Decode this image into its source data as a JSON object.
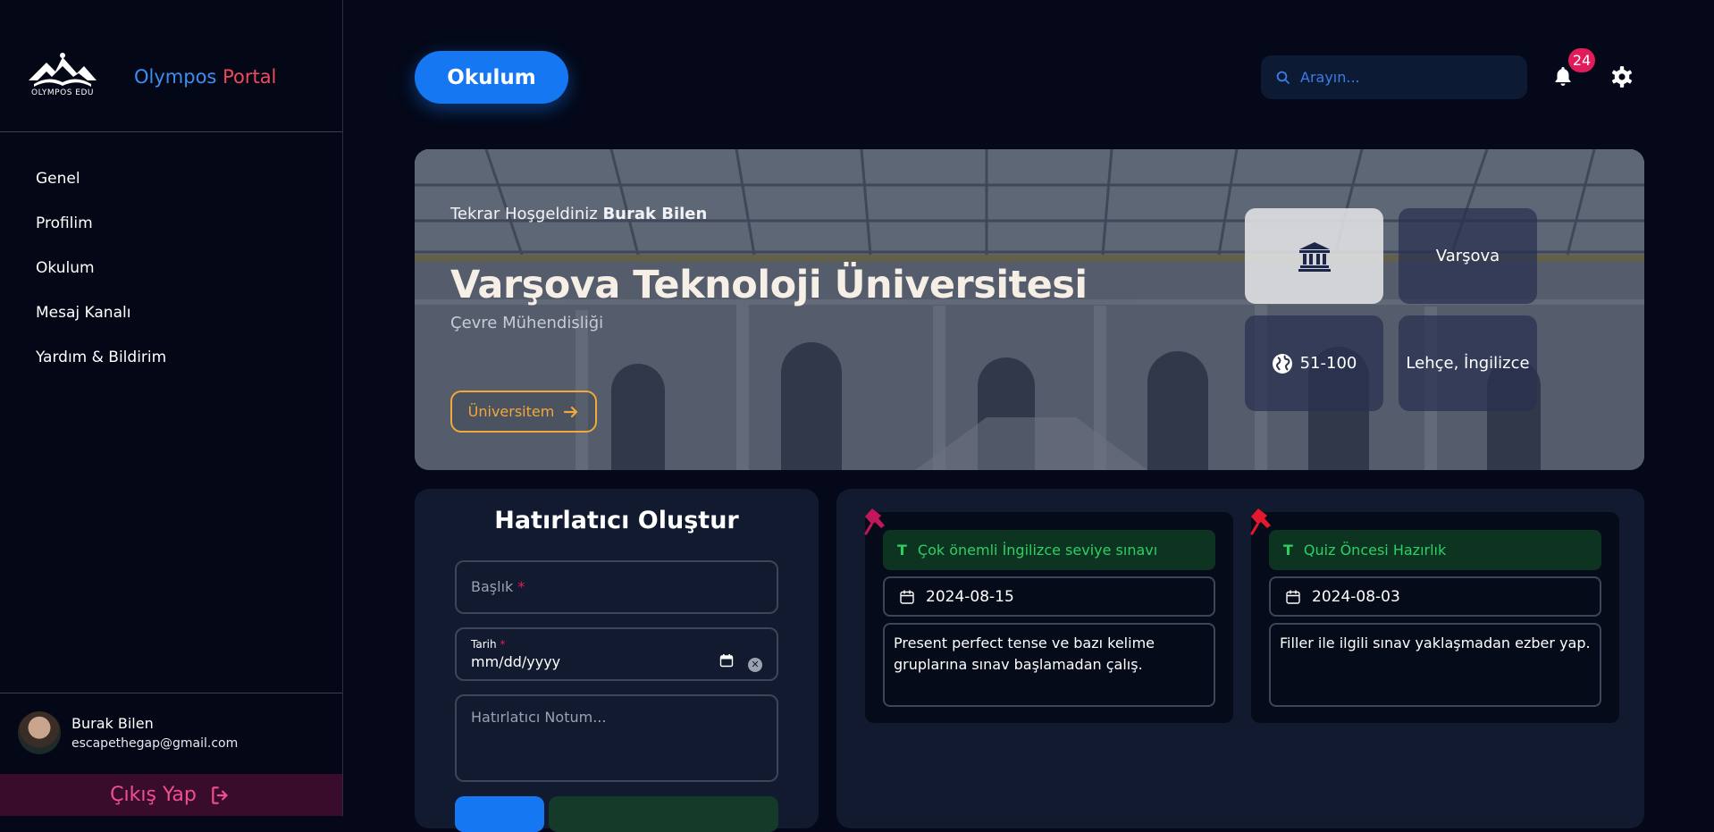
{
  "sidebar": {
    "logo_text": "OLYMPOS EDU",
    "brand_first": "Olympos",
    "brand_second": "Portal",
    "items": [
      {
        "label": "Genel"
      },
      {
        "label": "Profilim"
      },
      {
        "label": "Okulum"
      },
      {
        "label": "Mesaj Kanalı"
      },
      {
        "label": "Yardım & Bildirim"
      }
    ],
    "user": {
      "name": "Burak Bilen",
      "email": "escapethegap@gmail.com"
    },
    "logout_label": "Çıkış Yap"
  },
  "header": {
    "page_button": "Okulum",
    "search_placeholder": "Arayın...",
    "notification_count": "24"
  },
  "hero": {
    "welcome_prefix": "Tekrar Hoşgeldiniz",
    "welcome_name": "Burak Bilen",
    "university": "Varşova Teknoloji Üniversitesi",
    "department": "Çevre Mühendisliği",
    "button_label": "Üniversitem",
    "tiles": {
      "city": "Varşova",
      "ranking": "51-100",
      "languages": "Lehçe, İngilizce"
    }
  },
  "reminder_form": {
    "title": "Hatırlatıcı Oluştur",
    "title_field": "Başlık",
    "date_label": "Tarih",
    "date_placeholder": "mm/dd/yyyy",
    "note_placeholder": "Hatırlatıcı Notum..."
  },
  "notes": [
    {
      "title": "Çok önemli İngilizce seviye sınavı",
      "date": "2024-08-15",
      "body": "Present perfect tense ve bazı kelime gruplarına sınav başlamadan çalış."
    },
    {
      "title": "Quiz Öncesi Hazırlık",
      "date": "2024-08-03",
      "body": "Filler ile ilgili sınav yaklaşmadan ezber yap."
    }
  ],
  "colors": {
    "accent": "#1677f2",
    "brand_red": "#ef4a5c",
    "note_green": "#2fcf63",
    "badge": "#e21b5a",
    "button_orange": "#f2a83a",
    "logout_pink": "#f0508e"
  }
}
